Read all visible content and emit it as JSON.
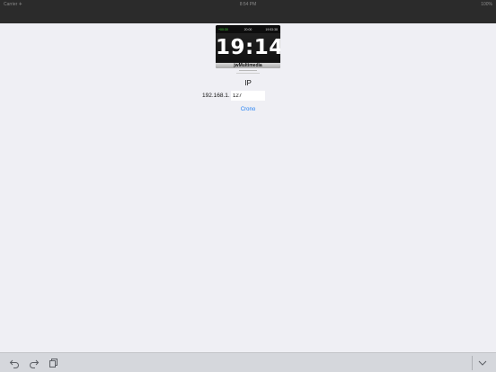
{
  "status_bar": {
    "carrier": "Carrier ✈",
    "time": "8:54 PM",
    "battery": "100%"
  },
  "clock_widget": {
    "left_small": "+00:30",
    "mid_small": "20:00",
    "right_small": "19:53:38",
    "time": "19:14",
    "brand": "jwMultimedia"
  },
  "form": {
    "ip_label": "IP",
    "ip_prefix": "192.168.1.",
    "ip_value": "127",
    "link_label": "Crono"
  },
  "keyboard_toolbar": {
    "undo_icon": "undo-icon",
    "redo_icon": "redo-icon",
    "paste_icon": "paste-icon",
    "dismiss_icon": "keyboard-dismiss-icon"
  }
}
